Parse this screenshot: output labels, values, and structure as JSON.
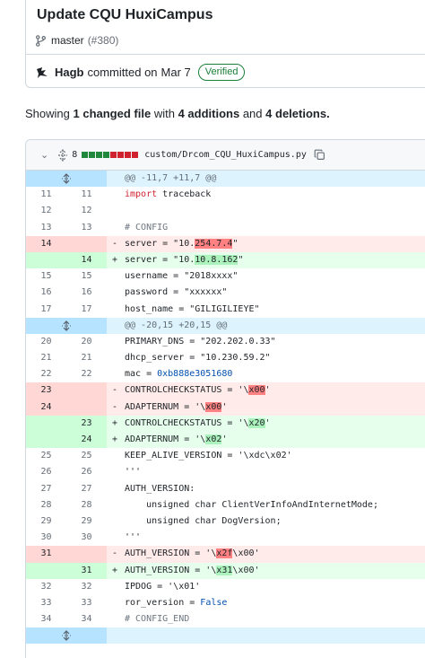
{
  "commit": {
    "title": "Update CQU HuxiCampus",
    "branch": "master",
    "pr_ref": "(#380)",
    "author": "Hagb",
    "committed_text": "committed on",
    "date": "Mar 7",
    "verified_label": "Verified"
  },
  "summary": {
    "prefix": "Showing",
    "changed_count": "1 changed file",
    "with_text": "with",
    "additions": "4 additions",
    "and_text": "and",
    "deletions": "4 deletions."
  },
  "file": {
    "change_count": "8",
    "path": "custom/Drcom_CQU_HuxiCampus.py",
    "diffstat": [
      "add",
      "add",
      "add",
      "add",
      "del",
      "del",
      "del",
      "del"
    ]
  },
  "diff_lines": [
    {
      "type": "hunk",
      "text": "@@ -11,7 +11,7 @@"
    },
    {
      "type": "ctx",
      "old": "11",
      "new": "11",
      "tokens": [
        {
          "t": "import",
          "c": "kw"
        },
        {
          "t": " traceback"
        }
      ]
    },
    {
      "type": "ctx",
      "old": "12",
      "new": "12",
      "tokens": []
    },
    {
      "type": "ctx",
      "old": "13",
      "new": "13",
      "tokens": [
        {
          "t": "# CONFIG",
          "c": "cmt"
        }
      ]
    },
    {
      "type": "del",
      "old": "14",
      "new": "",
      "tokens": [
        {
          "t": "server = \"10."
        },
        {
          "t": "254.7.4",
          "c": "hl-del"
        },
        {
          "t": "\""
        }
      ]
    },
    {
      "type": "add",
      "old": "",
      "new": "14",
      "tokens": [
        {
          "t": "server = \"10."
        },
        {
          "t": "10.8.162",
          "c": "hl-add"
        },
        {
          "t": "\""
        }
      ]
    },
    {
      "type": "ctx",
      "old": "15",
      "new": "15",
      "tokens": [
        {
          "t": "username = \"2018xxxx\""
        }
      ]
    },
    {
      "type": "ctx",
      "old": "16",
      "new": "16",
      "tokens": [
        {
          "t": "password = \"xxxxxx\""
        }
      ]
    },
    {
      "type": "ctx",
      "old": "17",
      "new": "17",
      "tokens": [
        {
          "t": "host_name = \"GILIGILIEYE\""
        }
      ]
    },
    {
      "type": "hunk",
      "text": "@@ -20,15 +20,15 @@"
    },
    {
      "type": "ctx",
      "old": "20",
      "new": "20",
      "tokens": [
        {
          "t": "PRIMARY_DNS = \"202.202.0.33\""
        }
      ]
    },
    {
      "type": "ctx",
      "old": "21",
      "new": "21",
      "tokens": [
        {
          "t": "dhcp_server = \"10.230.59.2\""
        }
      ]
    },
    {
      "type": "ctx",
      "old": "22",
      "new": "22",
      "tokens": [
        {
          "t": "mac = "
        },
        {
          "t": "0xb888e3051680",
          "c": "const"
        }
      ]
    },
    {
      "type": "del",
      "old": "23",
      "new": "",
      "tokens": [
        {
          "t": "CONTROLCHECKSTATUS = '\\"
        },
        {
          "t": "x00",
          "c": "hl-del"
        },
        {
          "t": "'"
        }
      ]
    },
    {
      "type": "del",
      "old": "24",
      "new": "",
      "tokens": [
        {
          "t": "ADAPTERNUM = '\\"
        },
        {
          "t": "x00",
          "c": "hl-del"
        },
        {
          "t": "'"
        }
      ]
    },
    {
      "type": "add",
      "old": "",
      "new": "23",
      "tokens": [
        {
          "t": "CONTROLCHECKSTATUS = '\\"
        },
        {
          "t": "x20",
          "c": "hl-add"
        },
        {
          "t": "'"
        }
      ]
    },
    {
      "type": "add",
      "old": "",
      "new": "24",
      "tokens": [
        {
          "t": "ADAPTERNUM = '\\"
        },
        {
          "t": "x02",
          "c": "hl-add"
        },
        {
          "t": "'"
        }
      ]
    },
    {
      "type": "ctx",
      "old": "25",
      "new": "25",
      "tokens": [
        {
          "t": "KEEP_ALIVE_VERSION = '\\xdc\\x02'"
        }
      ]
    },
    {
      "type": "ctx",
      "old": "26",
      "new": "26",
      "tokens": [
        {
          "t": "'''"
        }
      ]
    },
    {
      "type": "ctx",
      "old": "27",
      "new": "27",
      "tokens": [
        {
          "t": "AUTH_VERSION:"
        }
      ]
    },
    {
      "type": "ctx",
      "old": "28",
      "new": "28",
      "tokens": [
        {
          "t": "    unsigned char ClientVerInfoAndInternetMode;"
        }
      ]
    },
    {
      "type": "ctx",
      "old": "29",
      "new": "29",
      "tokens": [
        {
          "t": "    unsigned char DogVersion;"
        }
      ]
    },
    {
      "type": "ctx",
      "old": "30",
      "new": "30",
      "tokens": [
        {
          "t": "'''"
        }
      ]
    },
    {
      "type": "del",
      "old": "31",
      "new": "",
      "tokens": [
        {
          "t": "AUTH_VERSION = '\\"
        },
        {
          "t": "x2f",
          "c": "hl-del"
        },
        {
          "t": "\\x00'"
        }
      ]
    },
    {
      "type": "add",
      "old": "",
      "new": "31",
      "tokens": [
        {
          "t": "AUTH_VERSION = '\\"
        },
        {
          "t": "x31",
          "c": "hl-add"
        },
        {
          "t": "\\x00'"
        }
      ]
    },
    {
      "type": "ctx",
      "old": "32",
      "new": "32",
      "tokens": [
        {
          "t": "IPDOG = '\\x01'"
        }
      ]
    },
    {
      "type": "ctx",
      "old": "33",
      "new": "33",
      "tokens": [
        {
          "t": "ror_version = "
        },
        {
          "t": "False",
          "c": "const"
        }
      ]
    },
    {
      "type": "ctx",
      "old": "34",
      "new": "34",
      "tokens": [
        {
          "t": "# CONFIG_END",
          "c": "cmt"
        }
      ]
    },
    {
      "type": "hunk",
      "text": ""
    }
  ]
}
